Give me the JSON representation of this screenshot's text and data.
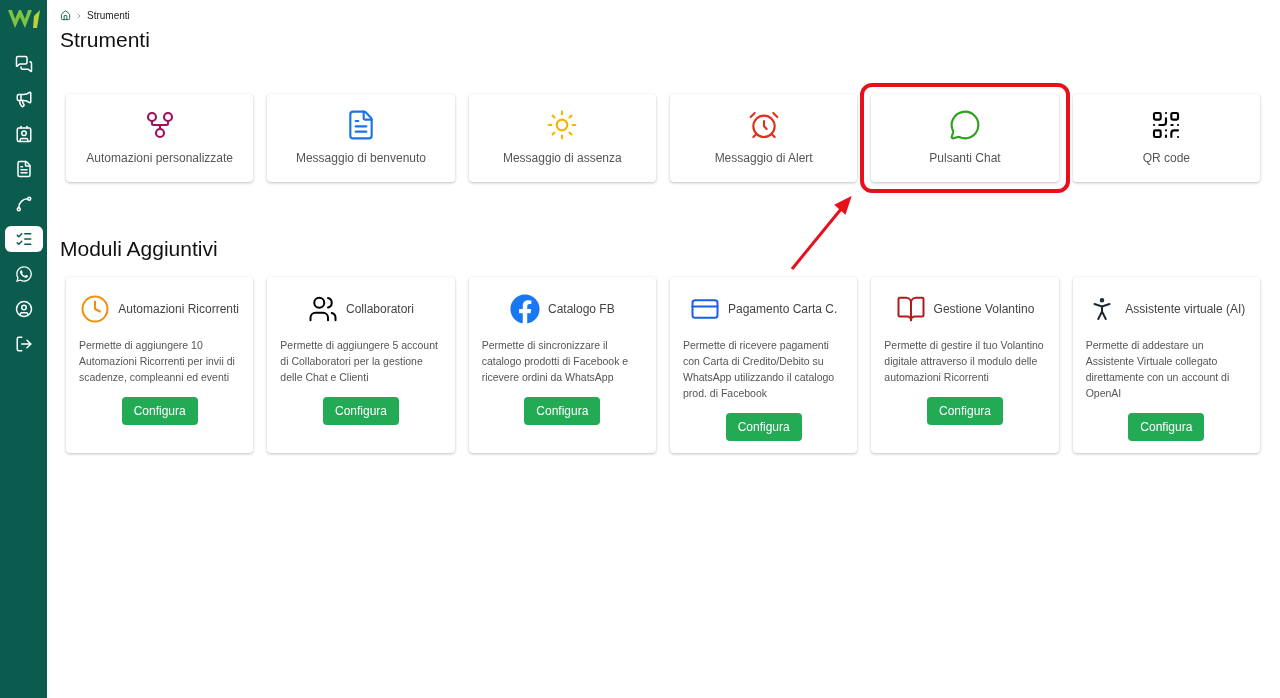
{
  "sidebar": {
    "items": [
      {
        "kind": "chats",
        "selected": false
      },
      {
        "kind": "campaigns",
        "selected": false
      },
      {
        "kind": "contacts",
        "selected": false
      },
      {
        "kind": "templates",
        "selected": false
      },
      {
        "kind": "flows",
        "selected": false
      },
      {
        "kind": "tools",
        "selected": true
      },
      {
        "kind": "whatsapp",
        "selected": false
      },
      {
        "kind": "account",
        "selected": false
      },
      {
        "kind": "logout",
        "selected": false
      }
    ]
  },
  "breadcrumb": {
    "items": [
      "Strumenti"
    ]
  },
  "title": "Strumenti",
  "tools": [
    {
      "kind": "fork",
      "label": "Automazioni personalizzate",
      "highlighted": false
    },
    {
      "kind": "document",
      "label": "Messaggio di benvenuto",
      "highlighted": false
    },
    {
      "kind": "sun",
      "label": "Messaggio di assenza",
      "highlighted": false
    },
    {
      "kind": "alarm",
      "label": "Messaggio di Alert",
      "highlighted": false
    },
    {
      "kind": "chat",
      "label": "Pulsanti Chat",
      "highlighted": true
    },
    {
      "kind": "qr",
      "label": "QR code",
      "highlighted": false
    }
  ],
  "modules_title": "Moduli Aggiuntivi",
  "modules": [
    {
      "kind": "clock",
      "title": "Automazioni Ricorrenti",
      "description": "Permette di aggiungere 10 Automazioni Ricorrenti per invii di scadenze, compleanni ed eventi",
      "button": "Configura"
    },
    {
      "kind": "users",
      "title": "Collaboratori",
      "description": "Permette di aggiungere 5 account di Collaboratori per la gestione delle Chat e Clienti",
      "button": "Configura"
    },
    {
      "kind": "facebook",
      "title": "Catalogo FB",
      "description": "Permette di sincronizzare il catalogo prodotti di Facebook e ricevere ordini da WhatsApp",
      "button": "Configura"
    },
    {
      "kind": "card",
      "title": "Pagamento Carta C.",
      "description": "Permette di ricevere pagamenti con Carta di Credito/Debito su WhatsApp utilizzando il catalogo prod. di Facebook",
      "button": "Configura"
    },
    {
      "kind": "book",
      "title": "Gestione Volantino",
      "description": "Permette di gestire il tuo Volantino digitale attraverso il modulo delle automazioni Ricorrenti",
      "button": "Configura"
    },
    {
      "kind": "person",
      "title": "Assistente virtuale (AI)",
      "description": "Permette di addestare un Assistente Virtuale collegato direttamente con un account di OpenAI",
      "button": "Configura"
    }
  ]
}
